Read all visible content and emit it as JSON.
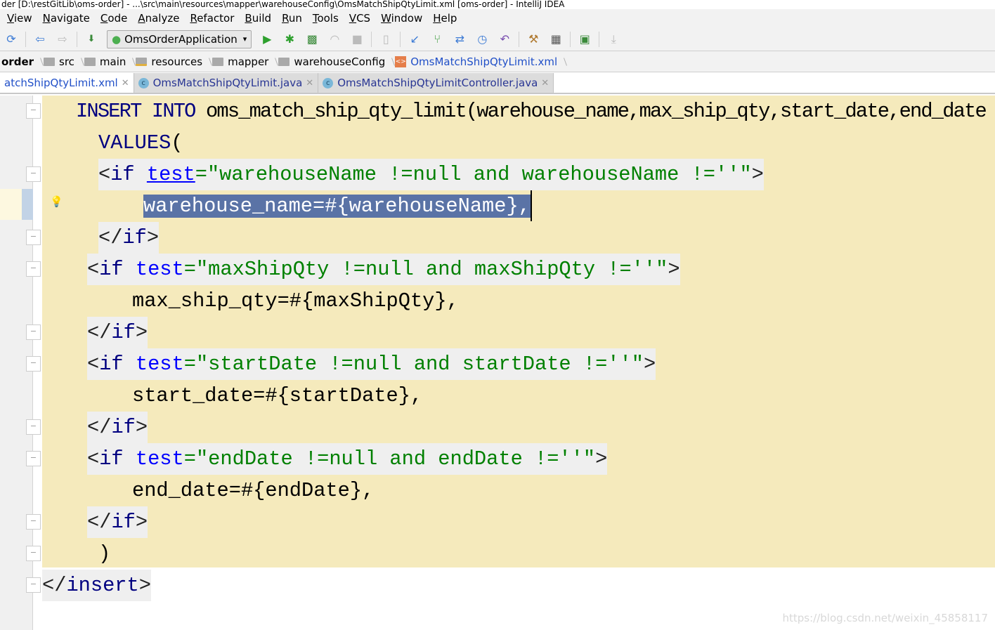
{
  "title": "der [D:\\restGitLib\\oms-order] - ...\\src\\main\\resources\\mapper\\warehouseConfig\\OmsMatchShipQtyLimit.xml [oms-order] - IntelliJ IDEA",
  "menu": [
    "View",
    "Navigate",
    "Code",
    "Analyze",
    "Refactor",
    "Build",
    "Run",
    "Tools",
    "VCS",
    "Window",
    "Help"
  ],
  "run_config": "OmsOrderApplication",
  "breadcrumbs": [
    "order",
    "src",
    "main",
    "resources",
    "mapper",
    "warehouseConfig",
    "OmsMatchShipQtyLimit.xml"
  ],
  "tabs": [
    {
      "label": "atchShipQtyLimit.xml",
      "active": true
    },
    {
      "label": "OmsMatchShipQtyLimit.java",
      "active": false
    },
    {
      "label": "OmsMatchShipQtyLimitController.java",
      "active": false
    }
  ],
  "code": [
    [
      [
        "kw",
        "INSERT INTO "
      ],
      [
        "txt",
        "oms_match_ship_qty_limit(warehouse_name,max_ship_qty,start_date,end_date"
      ]
    ],
    [
      [
        "kw",
        "VALUES"
      ],
      [
        "txt",
        "("
      ]
    ],
    [
      [
        "br",
        "<"
      ],
      [
        "tag",
        "if "
      ],
      [
        "attru",
        "test"
      ],
      [
        "val",
        "=\"warehouseName !=null and warehouseName !=''\""
      ],
      [
        "br",
        ">"
      ]
    ],
    [
      [
        "txt",
        "warehouse_name=#{warehouseName},"
      ]
    ],
    [
      [
        "br",
        "</"
      ],
      [
        "tag",
        "if"
      ],
      [
        "br",
        ">"
      ]
    ],
    [
      [
        "br",
        "<"
      ],
      [
        "tag",
        "if "
      ],
      [
        "attr",
        "test"
      ],
      [
        "val",
        "=\"maxShipQty !=null and maxShipQty !=''\""
      ],
      [
        "br",
        ">"
      ]
    ],
    [
      [
        "txt",
        "max_ship_qty=#{maxShipQty},"
      ]
    ],
    [
      [
        "br",
        "</"
      ],
      [
        "tag",
        "if"
      ],
      [
        "br",
        ">"
      ]
    ],
    [
      [
        "br",
        "<"
      ],
      [
        "tag",
        "if "
      ],
      [
        "attr",
        "test"
      ],
      [
        "val",
        "=\"startDate !=null and startDate !=''\""
      ],
      [
        "br",
        ">"
      ]
    ],
    [
      [
        "txt",
        "start_date=#{startDate},"
      ]
    ],
    [
      [
        "br",
        "</"
      ],
      [
        "tag",
        "if"
      ],
      [
        "br",
        ">"
      ]
    ],
    [
      [
        "br",
        "<"
      ],
      [
        "tag",
        "if "
      ],
      [
        "attr",
        "test"
      ],
      [
        "val",
        "=\"endDate !=null and endDate !=''\""
      ],
      [
        "br",
        ">"
      ]
    ],
    [
      [
        "txt",
        "end_date=#{endDate},"
      ]
    ],
    [
      [
        "br",
        "</"
      ],
      [
        "tag",
        "if"
      ],
      [
        "br",
        ">"
      ]
    ],
    [
      [
        "txt",
        ")"
      ]
    ],
    [
      [
        "br",
        "</"
      ],
      [
        "tag",
        "insert"
      ],
      [
        "br",
        ">"
      ]
    ]
  ],
  "selected_line": 4,
  "watermark": "https://blog.csdn.net/weixin_45858117"
}
